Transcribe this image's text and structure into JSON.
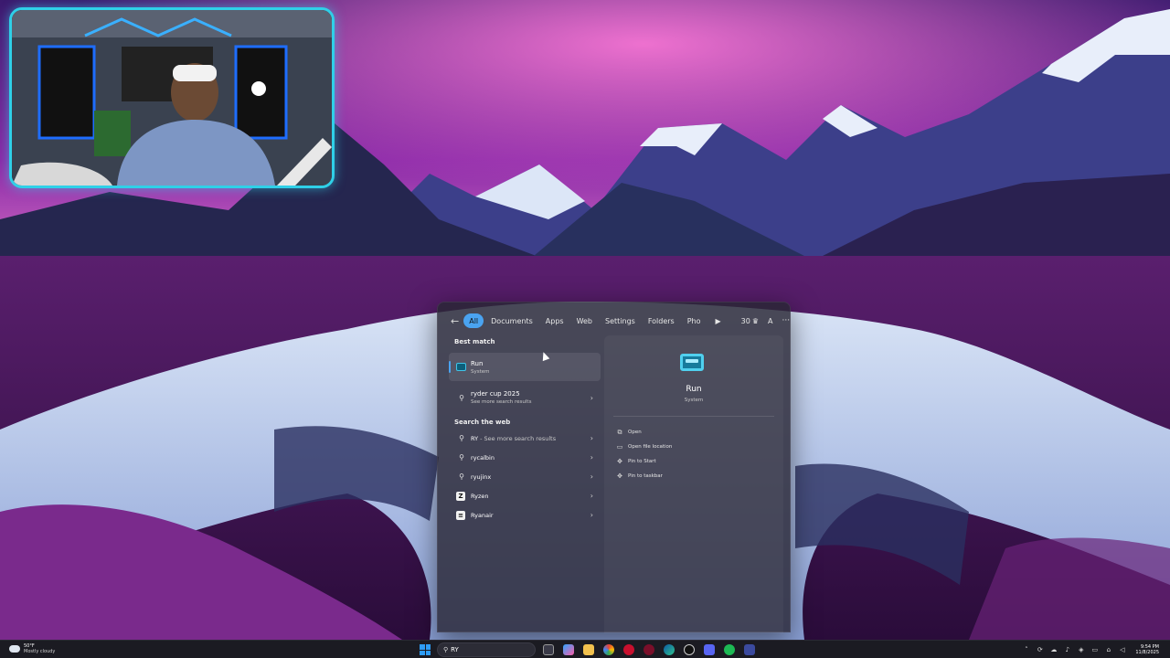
{
  "search_panel": {
    "filters": [
      "All",
      "Documents",
      "Apps",
      "Web",
      "Settings",
      "Folders",
      "Pho"
    ],
    "filter_count": "30",
    "user_initial": "A",
    "more_label": "···",
    "best_match_label": "Best match",
    "best_match": {
      "title": "Run",
      "subtitle": "System"
    },
    "suggestion": {
      "title": "ryder cup 2025",
      "subtitle": "See more search results"
    },
    "web_label": "Search the web",
    "web_results": [
      {
        "query": "RY",
        "suffix": " - See more search results"
      },
      {
        "query": "rycalbin"
      },
      {
        "query": "ryujinx"
      },
      {
        "query": "Ryzen"
      },
      {
        "query": "Ryanair"
      }
    ],
    "detail": {
      "title": "Run",
      "subtitle": "System",
      "actions": [
        "Open",
        "Open file location",
        "Pin to Start",
        "Pin to taskbar"
      ]
    }
  },
  "taskbar": {
    "weather_temp": "50°F",
    "weather_desc": "Mostly cloudy",
    "search_value": "RY",
    "time": "9:54 PM",
    "date": "11/8/2025"
  },
  "colors": {
    "accent": "#4aa3f0",
    "webcam_border": "#2fd0e8"
  }
}
